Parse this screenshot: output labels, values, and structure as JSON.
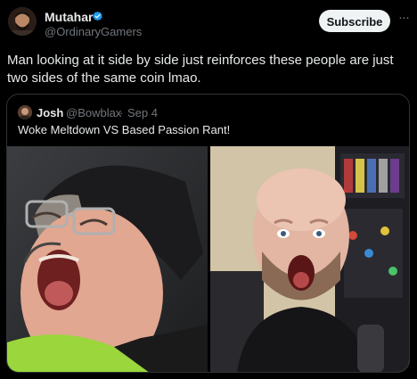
{
  "post": {
    "author_name": "Mutahar",
    "author_handle": "@OrdinaryGamers",
    "subscribe_label": "Subscribe",
    "more_label": "···",
    "text": "Man looking at it side by side just reinforces these people are just two sides of the same coin lmao."
  },
  "quote": {
    "author_name": "Josh",
    "author_handle": "@Bowblax",
    "separator": "·",
    "date": "Sep 4",
    "text": "Woke Meltdown VS Based Passion Rant!"
  },
  "colors": {
    "background": "#000000",
    "text_primary": "#e7e9ea",
    "text_secondary": "#71767b",
    "verified": "#1d9bf0",
    "border": "#2f3336"
  },
  "icons": {
    "verified": "verified-badge-icon",
    "more": "more-icon"
  }
}
